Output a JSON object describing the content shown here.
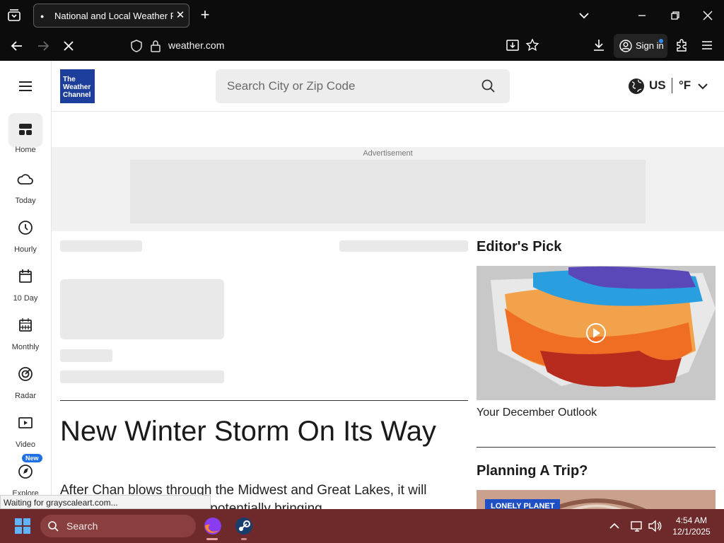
{
  "browser": {
    "tab_title": "National and Local Weather Radar",
    "url": "weather.com",
    "sign_in_label": "Sign in"
  },
  "site": {
    "logo_lines": [
      "The",
      "Weather",
      "Channel"
    ],
    "search_placeholder": "Search City or Zip Code",
    "country": "US",
    "unit": "°F",
    "ad_label": "Advertisement"
  },
  "sidenav": [
    {
      "label": "Home",
      "icon": "home-icon"
    },
    {
      "label": "Today",
      "icon": "cloud-icon"
    },
    {
      "label": "Hourly",
      "icon": "clock-icon"
    },
    {
      "label": "10 Day",
      "icon": "calendar-icon"
    },
    {
      "label": "Monthly",
      "icon": "calendar-grid-icon"
    },
    {
      "label": "Radar",
      "icon": "radar-icon"
    },
    {
      "label": "Video",
      "icon": "video-icon"
    },
    {
      "label": "Explore",
      "icon": "compass-icon",
      "badge": "New"
    }
  ],
  "article": {
    "headline": "New Winter Storm On Its Way",
    "summary": "After Chan blows through the Midwest and Great Lakes, it will move into the Northeast, potentially bringing"
  },
  "editors_pick": {
    "title": "Editor's Pick",
    "caption": "Your December Outlook"
  },
  "planning": {
    "title": "Planning A Trip?",
    "image_badge": "LONELY PLANET"
  },
  "status_text": "Waiting for grayscaleart.com...",
  "taskbar": {
    "search_label": "Search",
    "time": "4:54 AM",
    "date": "12/1/2025"
  },
  "colors": {
    "logo_blue": "#1d3e9b",
    "taskbar": "#6e2a2a",
    "new_badge": "#1f6fe5"
  }
}
